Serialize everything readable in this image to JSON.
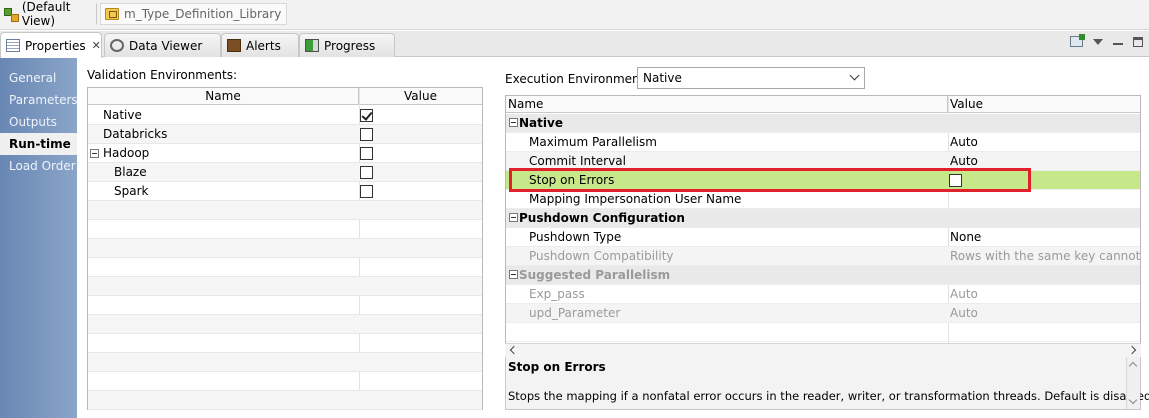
{
  "breadcrumbs": [
    {
      "label": "(Default View)",
      "icon": "view-icon"
    },
    {
      "label": "m_Type_Definition_Library",
      "icon": "folder-icon"
    }
  ],
  "tabs": [
    {
      "label": "Properties",
      "icon": "properties-icon",
      "active": true,
      "closable": true
    },
    {
      "label": "Data Viewer",
      "icon": "data-viewer-icon"
    },
    {
      "label": "Alerts",
      "icon": "alerts-icon"
    },
    {
      "label": "Progress",
      "icon": "progress-icon"
    }
  ],
  "sidebar": {
    "items": [
      {
        "label": "General"
      },
      {
        "label": "Parameters"
      },
      {
        "label": "Outputs"
      },
      {
        "label": "Run-time",
        "active": true
      },
      {
        "label": "Load Order"
      }
    ]
  },
  "validation": {
    "label": "Validation Environments:",
    "columns": [
      "Name",
      "Value"
    ],
    "rows": [
      {
        "name": "Native",
        "checked": true
      },
      {
        "name": "Databricks",
        "checked": false
      },
      {
        "name": "Hadoop",
        "checked": false,
        "expandable": true
      },
      {
        "name": "Blaze",
        "checked": false
      },
      {
        "name": "Spark",
        "checked": false
      }
    ]
  },
  "execution": {
    "label": "Execution Environment:",
    "selected": "Native"
  },
  "props_grid": {
    "columns": [
      "Name",
      "Value"
    ],
    "groups": [
      {
        "name": "Native",
        "rows": [
          {
            "name": "Maximum Parallelism",
            "value": "Auto"
          },
          {
            "name": "Commit Interval",
            "value": "Auto"
          },
          {
            "name": "Stop on Errors",
            "value": "",
            "checkbox": true,
            "highlighted": true
          },
          {
            "name": "Mapping Impersonation User Name",
            "value": ""
          }
        ]
      },
      {
        "name": "Pushdown Configuration",
        "rows": [
          {
            "name": "Pushdown Type",
            "value": "None"
          },
          {
            "name": "Pushdown Compatibility",
            "value": "Rows with the same key cannot be re",
            "disabled": true
          }
        ]
      },
      {
        "name": "Suggested Parallelism",
        "disabled": true,
        "rows": [
          {
            "name": "Exp_pass",
            "value": "Auto",
            "disabled": true
          },
          {
            "name": "upd_Parameter",
            "value": "Auto",
            "disabled": true
          }
        ]
      }
    ]
  },
  "description": {
    "title": "Stop on Errors",
    "text": "Stops the mapping if a nonfatal error occurs in the reader, writer, or transformation threads. Default is disabled."
  },
  "colors": {
    "highlight_row": "#c6e88a",
    "annotation_box": "#e0202a",
    "sidebar": "#6f8cb8"
  }
}
